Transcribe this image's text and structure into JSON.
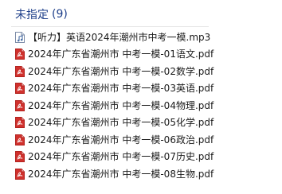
{
  "group": {
    "title": "未指定",
    "count": "(9)"
  },
  "files": [
    {
      "name": "【听力】英语2024年潮州市中考一模.mp3",
      "type": "audio"
    },
    {
      "name": "2024年广东省潮州市 中考一模-01语文.pdf",
      "type": "pdf"
    },
    {
      "name": "2024年广东省潮州市 中考一模-02数学.pdf",
      "type": "pdf"
    },
    {
      "name": "2024年广东省潮州市 中考一模-03英语.pdf",
      "type": "pdf"
    },
    {
      "name": "2024年广东省潮州市 中考一模-04物理.pdf",
      "type": "pdf"
    },
    {
      "name": "2024年广东省潮州市 中考一模-05化学.pdf",
      "type": "pdf"
    },
    {
      "name": "2024年广东省潮州市 中考一模-06政治.pdf",
      "type": "pdf"
    },
    {
      "name": "2024年广东省潮州市 中考一模-07历史.pdf",
      "type": "pdf"
    },
    {
      "name": "2024年广东省潮州市 中考一模-08生物.pdf",
      "type": "pdf"
    }
  ],
  "colors": {
    "header_text": "#1e3f8a",
    "pdf_icon": "#d0312d",
    "audio_icon": "#4a6fa5"
  }
}
